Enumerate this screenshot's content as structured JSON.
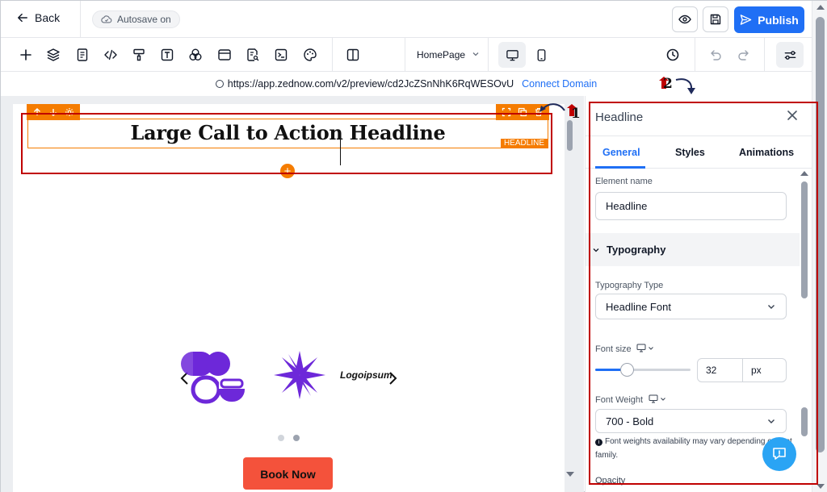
{
  "topbar": {
    "back_label": "Back",
    "autosave_label": "Autosave on",
    "publish_label": "Publish"
  },
  "toolbar": {
    "page_select": "HomePage"
  },
  "urlbar": {
    "url": "https://app.zednow.com/v2/preview/cd2JcZSnNhK6RqWESOvU",
    "connect_label": "Connect Domain"
  },
  "canvas": {
    "headline_text": "Large Call to Action Headline",
    "headline_tag": "HEADLINE",
    "logo_text": "Logoipsum",
    "cta_label": "Book Now",
    "carousel_dots": 2,
    "carousel_active": 2
  },
  "panel": {
    "title": "Headline",
    "tabs": [
      "General",
      "Styles",
      "Animations"
    ],
    "active_tab": "General",
    "element_name_label": "Element name",
    "element_name_value": "Headline",
    "typography_section": "Typography",
    "typography_type_label": "Typography Type",
    "typography_type_value": "Headline Font",
    "font_size_label": "Font size",
    "font_size_value": "32",
    "font_size_unit": "px",
    "font_size_slider_fraction": 0.33,
    "font_weight_label": "Font Weight",
    "font_weight_value": "700 - Bold",
    "font_weight_note": "Font weights availability may vary depending on font family.",
    "opacity_label": "Opacity"
  },
  "annotations": {
    "marker_1": "1",
    "marker_2": "2"
  },
  "colors": {
    "accent": "#1f6ff5",
    "selection": "#f57c00",
    "annotation": "#c00000",
    "cta": "#f4523b",
    "logo_purple": "#6d28d9"
  }
}
